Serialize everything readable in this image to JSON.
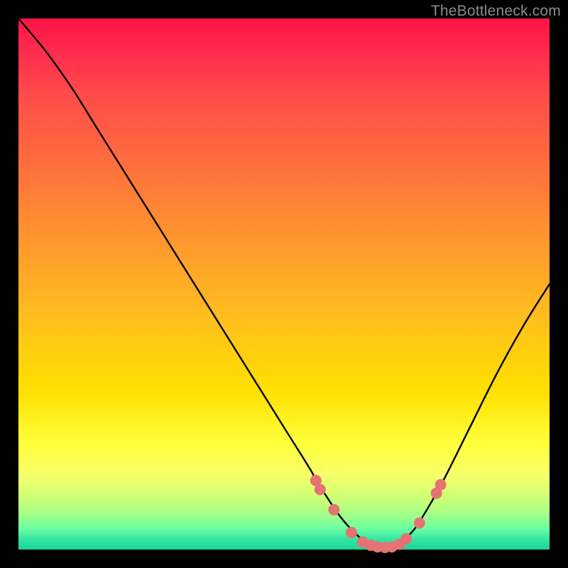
{
  "watermark": "TheBottleneck.com",
  "chart_data": {
    "type": "line",
    "title": "",
    "xlabel": "",
    "ylabel": "",
    "xlim": [
      0,
      100
    ],
    "ylim": [
      0,
      100
    ],
    "grid": false,
    "legend": false,
    "series": [
      {
        "name": "bottleneck-curve",
        "color": "#000000",
        "x": [
          0,
          5,
          10,
          15,
          20,
          25,
          30,
          35,
          40,
          45,
          50,
          55,
          56,
          58,
          60,
          62,
          64,
          66,
          68,
          70,
          72,
          74,
          76,
          80,
          85,
          90,
          95,
          100
        ],
        "y": [
          100,
          94,
          87,
          79,
          71,
          63,
          55,
          47,
          39,
          31,
          23,
          15,
          13,
          10,
          7,
          4.5,
          2.5,
          1.2,
          0.5,
          0.5,
          1.4,
          3.2,
          6,
          13,
          23,
          33,
          42,
          50
        ]
      }
    ],
    "markers": [
      {
        "name": "highlight-dots",
        "color": "#e57373",
        "radius_px": 8,
        "points_xy": [
          [
            56,
            13
          ],
          [
            56.8,
            11.3
          ],
          [
            59.4,
            7.5
          ],
          [
            62.7,
            3.2
          ],
          [
            64.8,
            1.4
          ],
          [
            66.3,
            0.8
          ],
          [
            67.6,
            0.5
          ],
          [
            69.0,
            0.4
          ],
          [
            70.3,
            0.5
          ],
          [
            71.8,
            1.0
          ],
          [
            73.0,
            2.0
          ],
          [
            75.5,
            5.0
          ],
          [
            78.7,
            10.6
          ],
          [
            79.5,
            12.2
          ]
        ]
      }
    ]
  }
}
